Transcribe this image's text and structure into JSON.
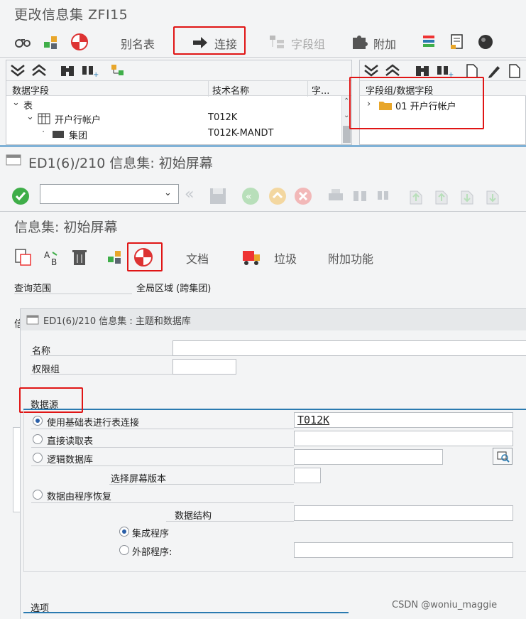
{
  "top_window": {
    "title": "更改信息集 ZFI15",
    "toolbar": {
      "alias_label": "别名表",
      "join_label": "连接",
      "field_group_label": "字段组",
      "extra_label": "附加"
    },
    "left_tree": {
      "col_data_field": "数据字段",
      "col_tech_name": "技术名称",
      "col_short": "字...",
      "rows": [
        {
          "label": "表",
          "tech": ""
        },
        {
          "label": "开户行帐户",
          "tech": "T012K"
        },
        {
          "label": "集团",
          "tech": "T012K-MANDT"
        }
      ]
    },
    "right_tree": {
      "header": "字段组/数据字段",
      "rows": [
        {
          "label": "01 开户行帐户"
        }
      ]
    }
  },
  "mid_window": {
    "title": "ED1(6)/210 信息集: 初始屏幕",
    "subtitle": "信息集: 初始屏幕",
    "toolbar": {
      "doc_label": "文档",
      "trash_label": "垃圾",
      "extra_label": "附加功能"
    },
    "query_scope_label": "查询范围",
    "query_scope_value": "全局区域 (跨集团)",
    "partial_label": "信"
  },
  "dialog": {
    "title": "ED1(6)/210 信息集 : 主题和数据库",
    "name_label": "名称",
    "name_value": "",
    "auth_group_label": "权限组",
    "auth_group_value": "",
    "data_source_tab": "数据源",
    "options": {
      "table_join_label": "使用基础表进行表连接",
      "table_join_value": "T012K",
      "direct_read_label": "直接读取表",
      "logical_db_label": "逻辑数据库",
      "screen_version_label": "选择屏幕版本",
      "program_label": "数据由程序恢复",
      "data_structure_label": "数据结构",
      "integrated_label": "集成程序",
      "external_label": "外部程序:"
    },
    "options_tab": "选项"
  },
  "watermark_credit": "CSDN @woniu_maggie",
  "colors": {
    "highlight_red": "#e01515",
    "accent_blue": "#2a7ab0",
    "success_green": "#3fae49"
  }
}
